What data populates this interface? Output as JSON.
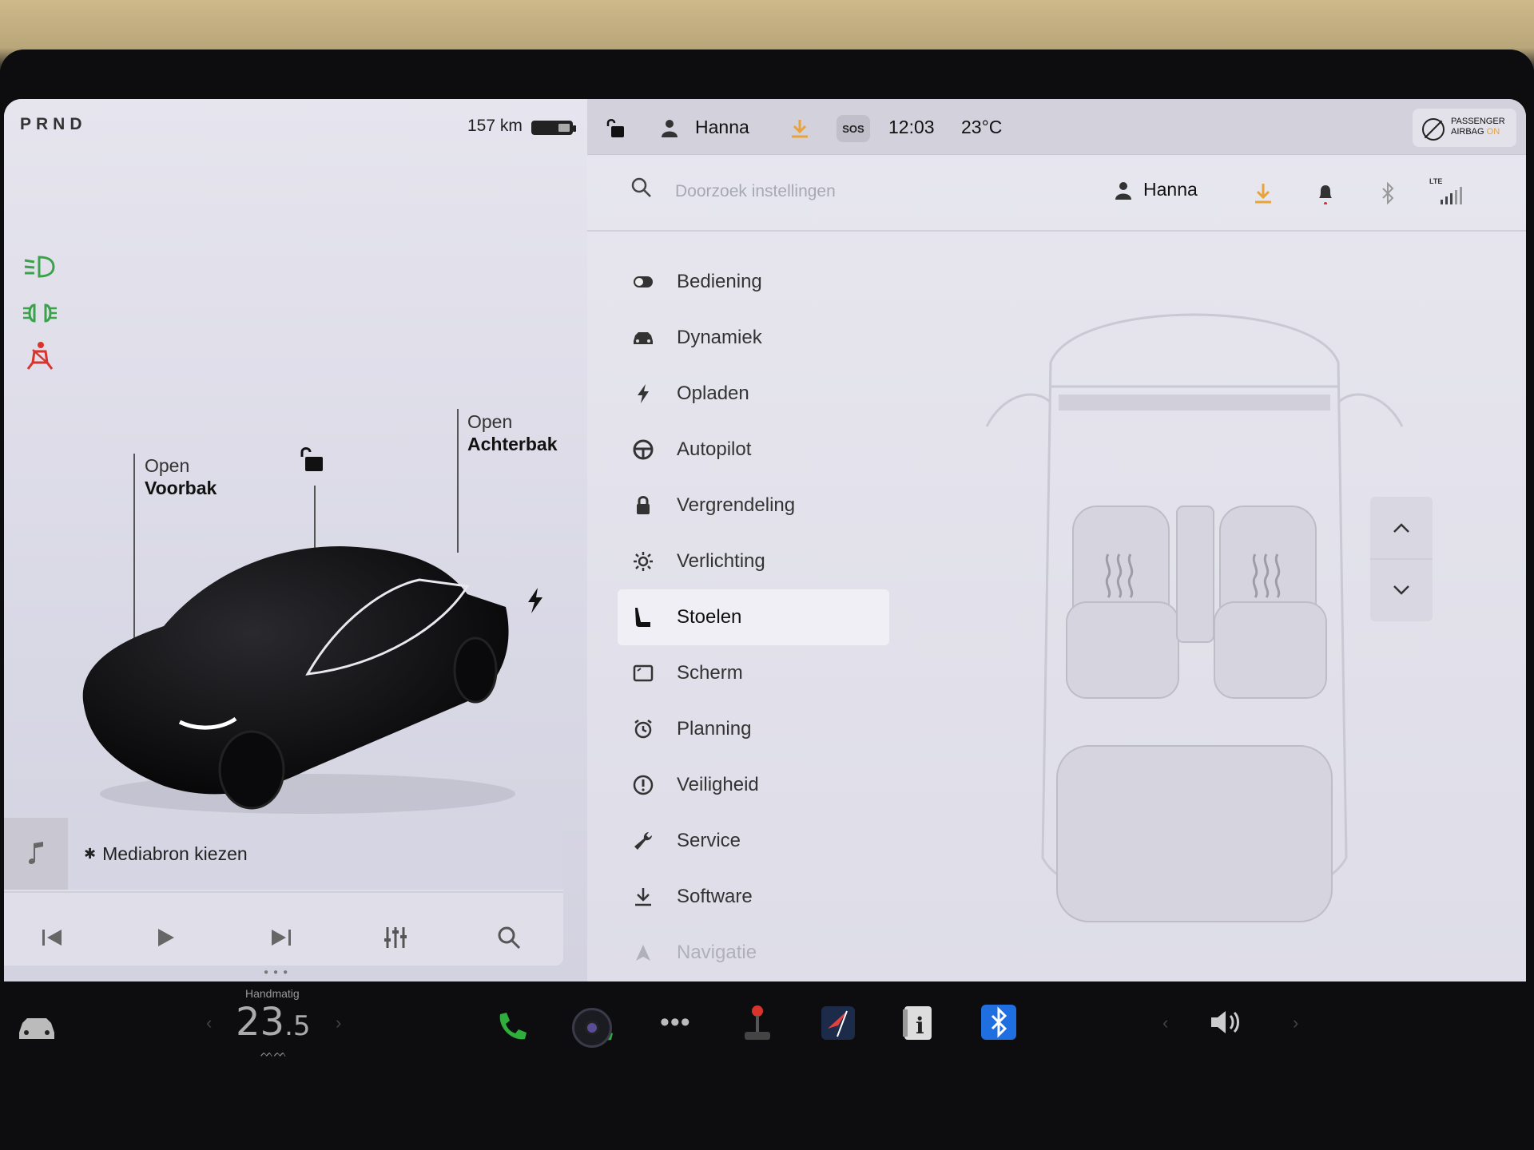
{
  "gear": "PRND",
  "range": "157 km",
  "left_panel": {
    "frunk": {
      "line1": "Open",
      "line2": "Voorbak"
    },
    "trunk": {
      "line1": "Open",
      "line2": "Achterbak"
    }
  },
  "media": {
    "source_label": "Mediabron kiezen"
  },
  "status": {
    "user": "Hanna",
    "sos": "SOS",
    "time": "12:03",
    "temperature": "23°C",
    "airbag_line1": "PASSENGER",
    "airbag_line2": "AIRBAG",
    "airbag_state": "ON"
  },
  "settings": {
    "search_placeholder": "Doorzoek instellingen",
    "user": "Hanna",
    "lte": "LTE",
    "menu": [
      {
        "label": "Bediening",
        "icon": "toggle-icon"
      },
      {
        "label": "Dynamiek",
        "icon": "car-icon"
      },
      {
        "label": "Opladen",
        "icon": "bolt-icon"
      },
      {
        "label": "Autopilot",
        "icon": "steering-wheel-icon"
      },
      {
        "label": "Vergrendeling",
        "icon": "lock-icon"
      },
      {
        "label": "Verlichting",
        "icon": "sun-icon"
      },
      {
        "label": "Stoelen",
        "icon": "seat-icon"
      },
      {
        "label": "Scherm",
        "icon": "display-icon"
      },
      {
        "label": "Planning",
        "icon": "alarm-clock-icon"
      },
      {
        "label": "Veiligheid",
        "icon": "alert-circle-icon"
      },
      {
        "label": "Service",
        "icon": "wrench-icon"
      },
      {
        "label": "Software",
        "icon": "download-icon"
      },
      {
        "label": "Navigatie",
        "icon": "navigation-icon"
      }
    ],
    "active": "Stoelen"
  },
  "dock": {
    "climate_mode": "Handmatig",
    "temp_whole": "23",
    "temp_decimal": ".5"
  },
  "colors": {
    "accent_orange": "#e8a33a",
    "warning_red": "#d9342b",
    "light_green": "#3aa34a",
    "bluetooth_blue": "#1f6fe0"
  }
}
